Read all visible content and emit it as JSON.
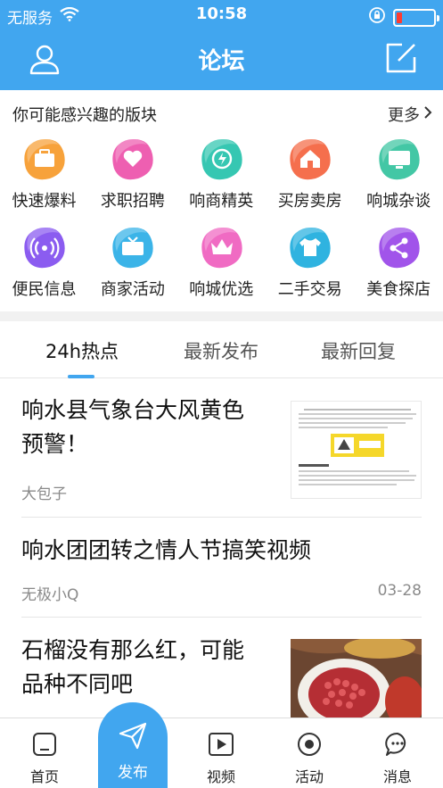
{
  "status_bar": {
    "carrier": "无服务",
    "time": "10:58"
  },
  "nav": {
    "title": "论坛"
  },
  "interest_section": {
    "title": "你可能感兴趣的版块",
    "more": "更多"
  },
  "categories": [
    {
      "label": "快速爆料",
      "icon": "briefcase-icon",
      "color": "#f7a23b"
    },
    {
      "label": "求职招聘",
      "icon": "heart-hand-icon",
      "color": "#ee5fb1"
    },
    {
      "label": "响商精英",
      "icon": "lightning-icon",
      "color": "#36c7b2"
    },
    {
      "label": "买房卖房",
      "icon": "house-icon",
      "color": "#f56f4d"
    },
    {
      "label": "响城杂谈",
      "icon": "monitor-icon",
      "color": "#43c7a5"
    },
    {
      "label": "便民信息",
      "icon": "broadcast-icon",
      "color": "#8b5cf0"
    },
    {
      "label": "商家活动",
      "icon": "tv-icon",
      "color": "#3bb4e8"
    },
    {
      "label": "响城优选",
      "icon": "crown-icon",
      "color": "#f06bc3"
    },
    {
      "label": "二手交易",
      "icon": "shirt-icon",
      "color": "#2fb3e0"
    },
    {
      "label": "美食探店",
      "icon": "share-icon",
      "color": "#a154ea"
    }
  ],
  "tabs": [
    {
      "label": "24h热点",
      "active": true
    },
    {
      "label": "最新发布",
      "active": false
    },
    {
      "label": "最新回复",
      "active": false
    }
  ],
  "posts": [
    {
      "title_line1": "响水县气象台大风黄色",
      "title_line2": "预警！",
      "author": "大包子",
      "date": ""
    },
    {
      "title_line1": "响水团团转之情人节搞笑视频",
      "title_line2": "",
      "author": "无极小Q",
      "date": "03-28"
    },
    {
      "title_line1": "石榴没有那么红，可能",
      "title_line2": "品种不同吧",
      "author": "",
      "date": ""
    }
  ],
  "bottom_nav": [
    {
      "label": "首页",
      "icon": "home-icon"
    },
    {
      "label": "发布",
      "icon": "paper-plane-icon"
    },
    {
      "label": "视频",
      "icon": "video-icon"
    },
    {
      "label": "活动",
      "icon": "activity-icon"
    },
    {
      "label": "消息",
      "icon": "message-icon"
    }
  ],
  "colors": {
    "primary": "#41a6ef",
    "battery_low": "#ff3b30"
  }
}
